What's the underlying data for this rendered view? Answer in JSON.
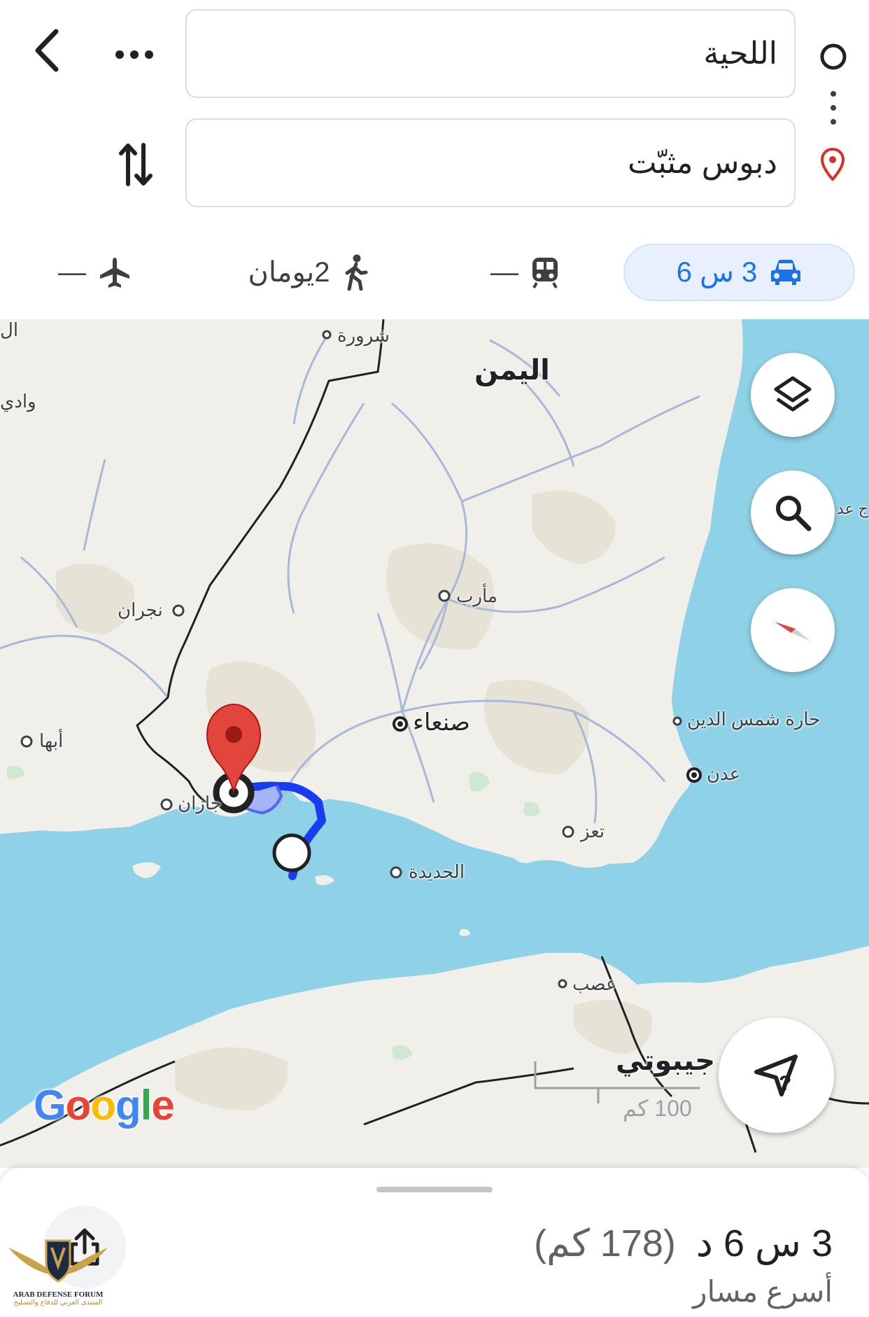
{
  "search": {
    "origin_value": "اللحية",
    "destination_value": "دبوس مثبّت",
    "back_icon": "chevron-left-icon",
    "more_icon": "more-horizontal-icon",
    "swap_icon": "swap-vertical-icon",
    "origin_icon": "circle-outline-icon",
    "destination_icon": "red-pin-icon"
  },
  "modes": [
    {
      "name": "drive",
      "label": "3 س 6",
      "icon": "car-icon",
      "selected": true
    },
    {
      "name": "transit",
      "label": "—",
      "icon": "train-icon",
      "selected": false
    },
    {
      "name": "walk",
      "label": "2يومان",
      "icon": "walk-icon",
      "selected": false
    },
    {
      "name": "flight",
      "label": "—",
      "icon": "plane-icon",
      "selected": false
    }
  ],
  "map": {
    "places": {
      "sharura": "شرورة",
      "yemen": "اليمن",
      "wadi": "وادي",
      "gulf": "ج عد",
      "najran": "نجران",
      "marib": "مأرب",
      "abha": "أبها",
      "sanaa": "صنعاء",
      "hara": "حارة شمس الدين",
      "aden": "عدن",
      "jazan": "جازان",
      "taiz": "تعز",
      "hudaydah": "الحديدة",
      "assab": "عصب",
      "djibouti": "جيبوتي",
      "edge_left": "ال"
    },
    "scale_label": "100 كم",
    "google_logo": "Google",
    "water_color": "#8fd1e6",
    "land_color": "#f1efe9",
    "route_color": "#1a3cf0",
    "controls": [
      "layers-icon",
      "search-icon",
      "compass-icon",
      "directions-help-icon"
    ]
  },
  "sheet": {
    "duration": "3 س 6 د",
    "distance": "(178 كم)",
    "route_note": "أسرع مسار",
    "share_icon": "share-icon",
    "watermark_text": "ARAB DEFENSE FORUM",
    "watermark_sub": "المنتدى العربي للدفاع والتسليح"
  }
}
